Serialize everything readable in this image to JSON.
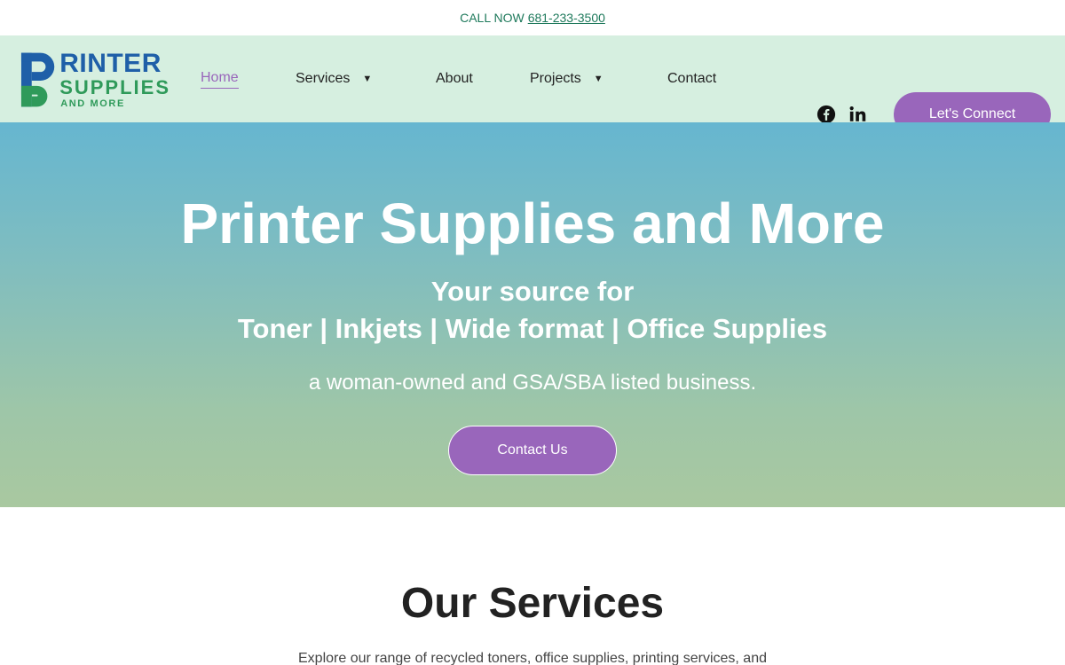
{
  "topbar": {
    "call_label": "CALL NOW",
    "phone": "681-233-3500"
  },
  "logo": {
    "letter": "P",
    "word1": "RINTER",
    "word2": "SUPPLIES",
    "word3": "AND MORE"
  },
  "nav": {
    "items": [
      {
        "label": "Home",
        "active": true
      },
      {
        "label": "Services",
        "caret": "▼"
      },
      {
        "label": "About"
      },
      {
        "label": "Projects",
        "caret": "▼"
      },
      {
        "label": "Contact"
      }
    ],
    "social": [
      "facebook-icon",
      "linkedin-icon"
    ],
    "connect_label": "Let's Connect"
  },
  "hero": {
    "title": "Printer Supplies and More",
    "subtitle_line1": "Your source for",
    "subtitle_line2": "Toner | Inkjets | Wide format | Office Supplies",
    "tagline": "a woman-owned and GSA/SBA listed business.",
    "cta_label": "Contact Us"
  },
  "services": {
    "title": "Our Services",
    "description": "Explore our range of recycled toners, office supplies, printing services, and"
  },
  "colors": {
    "accent": "#9966bb",
    "nav_bg": "#d6efe0",
    "brand_blue": "#1f5fa8",
    "brand_green": "#2f9a5a",
    "topbar_text": "#1f7a5c"
  }
}
